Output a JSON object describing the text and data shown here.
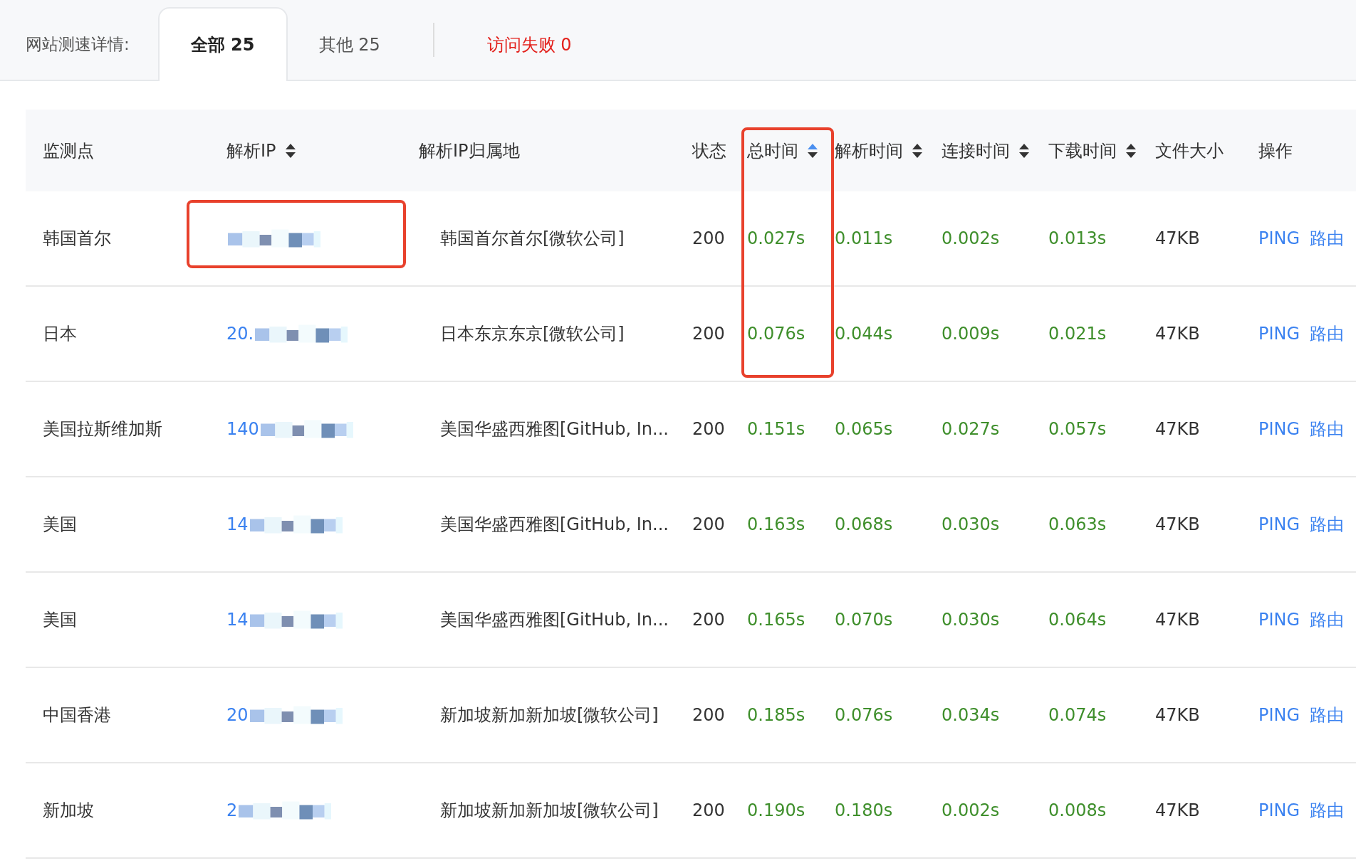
{
  "tabs_label": "网站测速详情:",
  "tabs": [
    {
      "label": "全部 25",
      "selected": true,
      "kind": "normal"
    },
    {
      "label": "其他 25",
      "selected": false,
      "kind": "normal"
    },
    {
      "label": "访问失败 0",
      "selected": false,
      "kind": "error"
    }
  ],
  "table": {
    "columns": [
      {
        "label": "监测点",
        "kind": "plain"
      },
      {
        "label": "解析IP",
        "kind": "sortable",
        "sort_ascending": false
      },
      {
        "label": "解析IP归属地",
        "kind": "plain"
      },
      {
        "label": "状态",
        "kind": "plain"
      },
      {
        "label": "总时间",
        "kind": "sortable",
        "sort_ascending": true
      },
      {
        "label": "解析时间",
        "kind": "sortable",
        "sort_ascending": false
      },
      {
        "label": "连接时间",
        "kind": "sortable",
        "sort_ascending": false
      },
      {
        "label": "下载时间",
        "kind": "sortable",
        "sort_ascending": false
      },
      {
        "label": "文件大小",
        "kind": "plain"
      },
      {
        "label": "操作",
        "kind": "plain"
      }
    ],
    "rows": [
      {
        "point": "韩国首尔",
        "location": "韩国首尔首尔[微软公司]",
        "status": "200",
        "total": "0.027s",
        "dns": "0.011s",
        "connect": "0.002s",
        "download": "0.013s",
        "size": "47KB",
        "actions": [
          "PING",
          "路由"
        ]
      },
      {
        "point": "日本",
        "ip_visible": "20.",
        "location": "日本东京东京[微软公司]",
        "status": "200",
        "total": "0.076s",
        "dns": "0.044s",
        "connect": "0.009s",
        "download": "0.021s",
        "size": "47KB",
        "actions": [
          "PING",
          "路由"
        ]
      },
      {
        "point": "美国拉斯维加斯",
        "ip_visible": "140",
        "location": "美国华盛西雅图[GitHub, In...",
        "status": "200",
        "total": "0.151s",
        "dns": "0.065s",
        "connect": "0.027s",
        "download": "0.057s",
        "size": "47KB",
        "actions": [
          "PING",
          "路由"
        ]
      },
      {
        "point": "美国",
        "ip_visible": "14",
        "location": "美国华盛西雅图[GitHub, In...",
        "status": "200",
        "total": "0.163s",
        "dns": "0.068s",
        "connect": "0.030s",
        "download": "0.063s",
        "size": "47KB",
        "actions": [
          "PING",
          "路由"
        ]
      },
      {
        "point": "美国",
        "ip_visible": "14",
        "location": "美国华盛西雅图[GitHub, In...",
        "status": "200",
        "total": "0.165s",
        "dns": "0.070s",
        "connect": "0.030s",
        "download": "0.064s",
        "size": "47KB",
        "actions": [
          "PING",
          "路由"
        ]
      },
      {
        "point": "中国香港",
        "ip_visible": "20",
        "location": "新加坡新加新加坡[微软公司]",
        "status": "200",
        "total": "0.185s",
        "dns": "0.076s",
        "connect": "0.034s",
        "download": "0.074s",
        "size": "47KB",
        "actions": [
          "PING",
          "路由"
        ]
      },
      {
        "point": "新加坡",
        "ip_visible": "2",
        "location": "新加坡新加新加坡[微软公司]",
        "status": "200",
        "total": "0.190s",
        "dns": "0.180s",
        "connect": "0.002s",
        "download": "0.008s",
        "size": "47KB",
        "actions": [
          "PING",
          "路由"
        ]
      }
    ]
  },
  "highlights": {
    "first_ip_cell": true,
    "total_time_column": true
  }
}
